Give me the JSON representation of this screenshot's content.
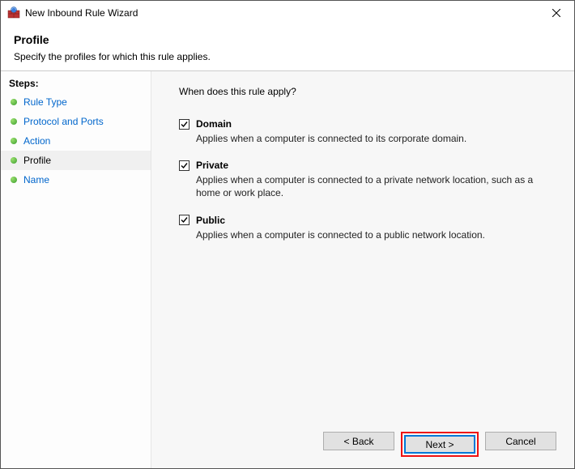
{
  "window": {
    "title": "New Inbound Rule Wizard"
  },
  "header": {
    "title": "Profile",
    "subtitle": "Specify the profiles for which this rule applies."
  },
  "sidebar": {
    "heading": "Steps:",
    "items": [
      {
        "label": "Rule Type",
        "state": "link"
      },
      {
        "label": "Protocol and Ports",
        "state": "link"
      },
      {
        "label": "Action",
        "state": "link"
      },
      {
        "label": "Profile",
        "state": "current"
      },
      {
        "label": "Name",
        "state": "link"
      }
    ]
  },
  "main": {
    "question": "When does this rule apply?",
    "options": [
      {
        "key": "domain",
        "label": "Domain",
        "checked": true,
        "description": "Applies when a computer is connected to its corporate domain."
      },
      {
        "key": "private",
        "label": "Private",
        "checked": true,
        "description": "Applies when a computer is connected to a private network location, such as a home or work place."
      },
      {
        "key": "public",
        "label": "Public",
        "checked": true,
        "description": "Applies when a computer is connected to a public network location."
      }
    ]
  },
  "buttons": {
    "back": "< Back",
    "next": "Next >",
    "cancel": "Cancel"
  }
}
